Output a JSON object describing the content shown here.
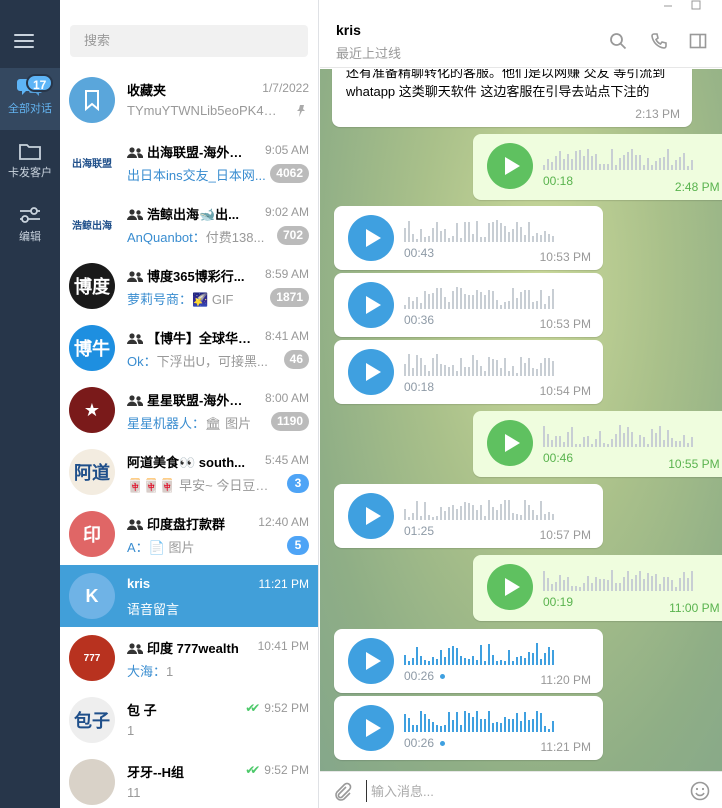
{
  "nav": {
    "unread_badge": "17",
    "items": [
      {
        "label": "全部对话",
        "icon": "chat-bubbles-icon"
      },
      {
        "label": "卡发客户",
        "icon": "folder-icon"
      },
      {
        "label": "编辑",
        "icon": "sliders-icon"
      }
    ]
  },
  "search": {
    "placeholder": "搜索"
  },
  "chats": [
    {
      "name": "收藏夹",
      "time": "1/7/2022",
      "who": "",
      "preview": "TYmuYTWNLib5eoPK4kZ...",
      "count": "",
      "group": false,
      "avatar_text": "",
      "avatar_color": "#5aa6db"
    },
    {
      "name": "出海联盟-海外资...",
      "time": "9:05 AM",
      "who": "",
      "preview": "出日本ins交友_日本网...",
      "count": "4062",
      "group": true,
      "avatar_text": "出海联盟",
      "avatar_color": "#ffffff"
    },
    {
      "name": "浩鲸出海🐋出...",
      "time": "9:02 AM",
      "who": "AnQuanbot：",
      "preview": "付费138...",
      "count": "702",
      "group": true,
      "avatar_text": "浩鲸出海",
      "avatar_color": "#ffffff"
    },
    {
      "name": "博度365博彩行...",
      "time": "8:59 AM",
      "who": "萝莉号商：",
      "preview": "🌠 GIF",
      "count": "1871",
      "group": true,
      "avatar_text": "博度",
      "avatar_color": "#1a1a1a"
    },
    {
      "name": "【博牛】全球华人...",
      "time": "8:41 AM",
      "who": "Ok：",
      "preview": "下浮出U，可接黑...",
      "count": "46",
      "group": true,
      "avatar_text": "博牛",
      "avatar_color": "#1e8fe0"
    },
    {
      "name": "星星联盟-海外资...",
      "time": "8:00 AM",
      "who": "星星机器人：",
      "preview": "🏛 图片",
      "count": "1190",
      "group": true,
      "avatar_text": "★",
      "avatar_color": "#7a1a1a"
    },
    {
      "name": "阿道美食👀 south...",
      "time": "5:45 AM",
      "who": "",
      "preview": "🀄🀄🀄 早安~ 今日豆浆...",
      "count": "3",
      "group": false,
      "avatar_text": "阿道",
      "avatar_color": "#f3ece0"
    },
    {
      "name": "印度盘打款群",
      "time": "12:40 AM",
      "who": "A：",
      "preview": "📄 图片",
      "count": "5",
      "group": true,
      "avatar_text": "印",
      "avatar_color": "#e06666"
    },
    {
      "name": "kris",
      "time": "11:21 PM",
      "who": "",
      "preview": "语音留言",
      "count": "",
      "group": false,
      "avatar_text": "K",
      "avatar_color": "#6fb3e6"
    },
    {
      "name": "印度 777wealth",
      "time": "10:41 PM",
      "who": "大海：",
      "preview": "1",
      "count": "",
      "group": true,
      "avatar_text": "777",
      "avatar_color": "#b8321f"
    },
    {
      "name": "包 子",
      "time": "9:52 PM",
      "who": "",
      "preview": "1",
      "count": "",
      "group": false,
      "avatar_text": "包子",
      "avatar_color": "#eeeeee",
      "read": true
    },
    {
      "name": "牙牙--H组",
      "time": "9:52 PM",
      "who": "",
      "preview": "11",
      "count": "",
      "group": false,
      "avatar_text": "",
      "avatar_color": "#d9d2c8",
      "read": true
    }
  ],
  "header": {
    "title": "kris",
    "status": "最近上过线"
  },
  "messages": [
    {
      "type": "text",
      "dir": "in",
      "text": "还有准备精聊转化的客服。他们是以网赚 交友 等引流到 whatapp 这类聊天软件 这边客服在引导去站点下注的",
      "time": "2:13 PM"
    },
    {
      "type": "voice",
      "dir": "out",
      "duration": "00:18",
      "time": "2:48 PM",
      "unplayed": false
    },
    {
      "type": "voice",
      "dir": "in",
      "duration": "00:43",
      "time": "10:53 PM",
      "unplayed": false
    },
    {
      "type": "voice",
      "dir": "in",
      "duration": "00:36",
      "time": "10:53 PM",
      "unplayed": false
    },
    {
      "type": "voice",
      "dir": "in",
      "duration": "00:18",
      "time": "10:54 PM",
      "unplayed": false
    },
    {
      "type": "voice",
      "dir": "out",
      "duration": "00:46",
      "time": "10:55 PM",
      "unplayed": false
    },
    {
      "type": "voice",
      "dir": "in",
      "duration": "01:25",
      "time": "10:57 PM",
      "unplayed": false
    },
    {
      "type": "voice",
      "dir": "out",
      "duration": "00:19",
      "time": "11:00 PM",
      "unplayed": false
    },
    {
      "type": "voice",
      "dir": "in",
      "duration": "00:26",
      "time": "11:20 PM",
      "unplayed": true
    },
    {
      "type": "voice",
      "dir": "in",
      "duration": "00:26",
      "time": "11:21 PM",
      "unplayed": true
    }
  ],
  "composer": {
    "placeholder": "输入消息..."
  },
  "colors": {
    "accent": "#419fd9",
    "rail": "#27364a",
    "voice_in": "#3fa0e0",
    "voice_out": "#5fc160",
    "bubble_out": "#effdde"
  }
}
